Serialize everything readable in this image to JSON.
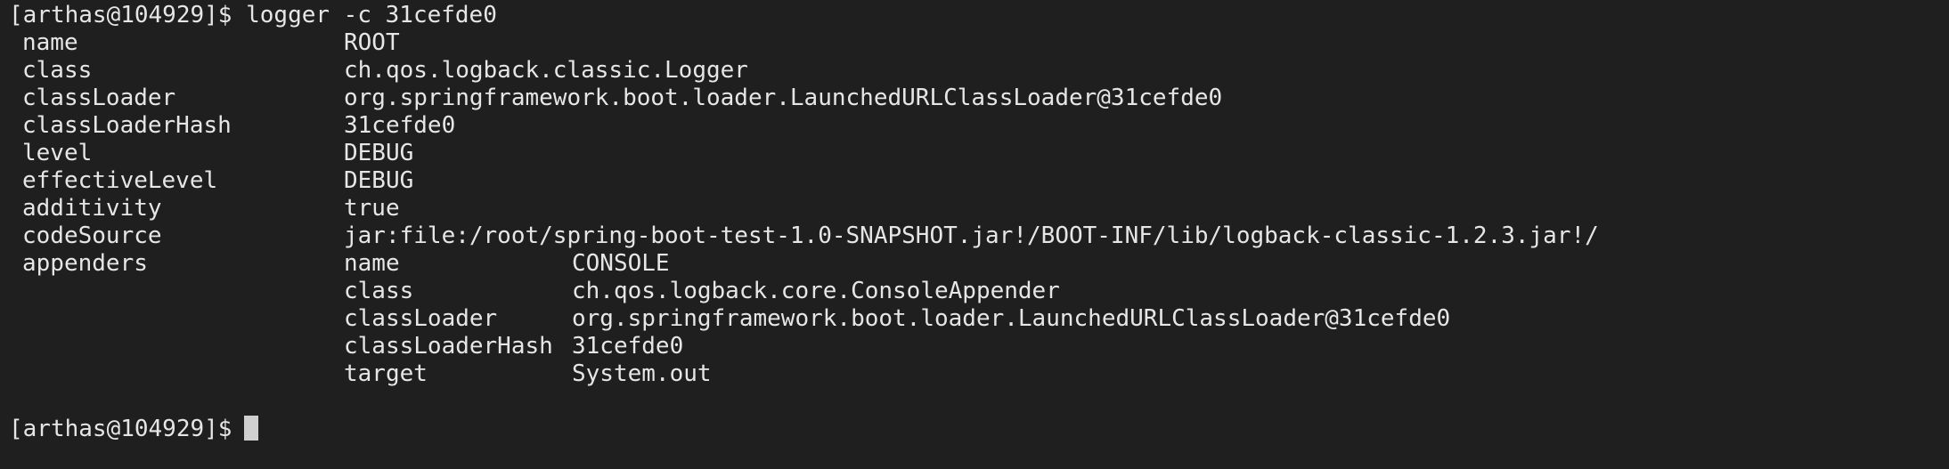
{
  "terminal": {
    "command_line": "[arthas@104929]$ logger -c 31cefde0",
    "fields": [
      {
        "key": "name",
        "value": "ROOT"
      },
      {
        "key": "class",
        "value": "ch.qos.logback.classic.Logger"
      },
      {
        "key": "classLoader",
        "value": "org.springframework.boot.loader.LaunchedURLClassLoader@31cefde0"
      },
      {
        "key": "classLoaderHash",
        "value": "31cefde0"
      },
      {
        "key": "level",
        "value": "DEBUG"
      },
      {
        "key": "effectiveLevel",
        "value": "DEBUG"
      },
      {
        "key": "additivity",
        "value": "true"
      },
      {
        "key": "codeSource",
        "value": "jar:file:/root/spring-boot-test-1.0-SNAPSHOT.jar!/BOOT-INF/lib/logback-classic-1.2.3.jar!/"
      }
    ],
    "appenders": {
      "key": "appenders",
      "entries": [
        {
          "key": "name",
          "value": "CONSOLE"
        },
        {
          "key": "class",
          "value": "ch.qos.logback.core.ConsoleAppender"
        },
        {
          "key": "classLoader",
          "value": "org.springframework.boot.loader.LaunchedURLClassLoader@31cefde0"
        },
        {
          "key": "classLoaderHash",
          "value": "31cefde0"
        },
        {
          "key": "target",
          "value": "System.out"
        }
      ]
    },
    "prompt": "[arthas@104929]$"
  }
}
